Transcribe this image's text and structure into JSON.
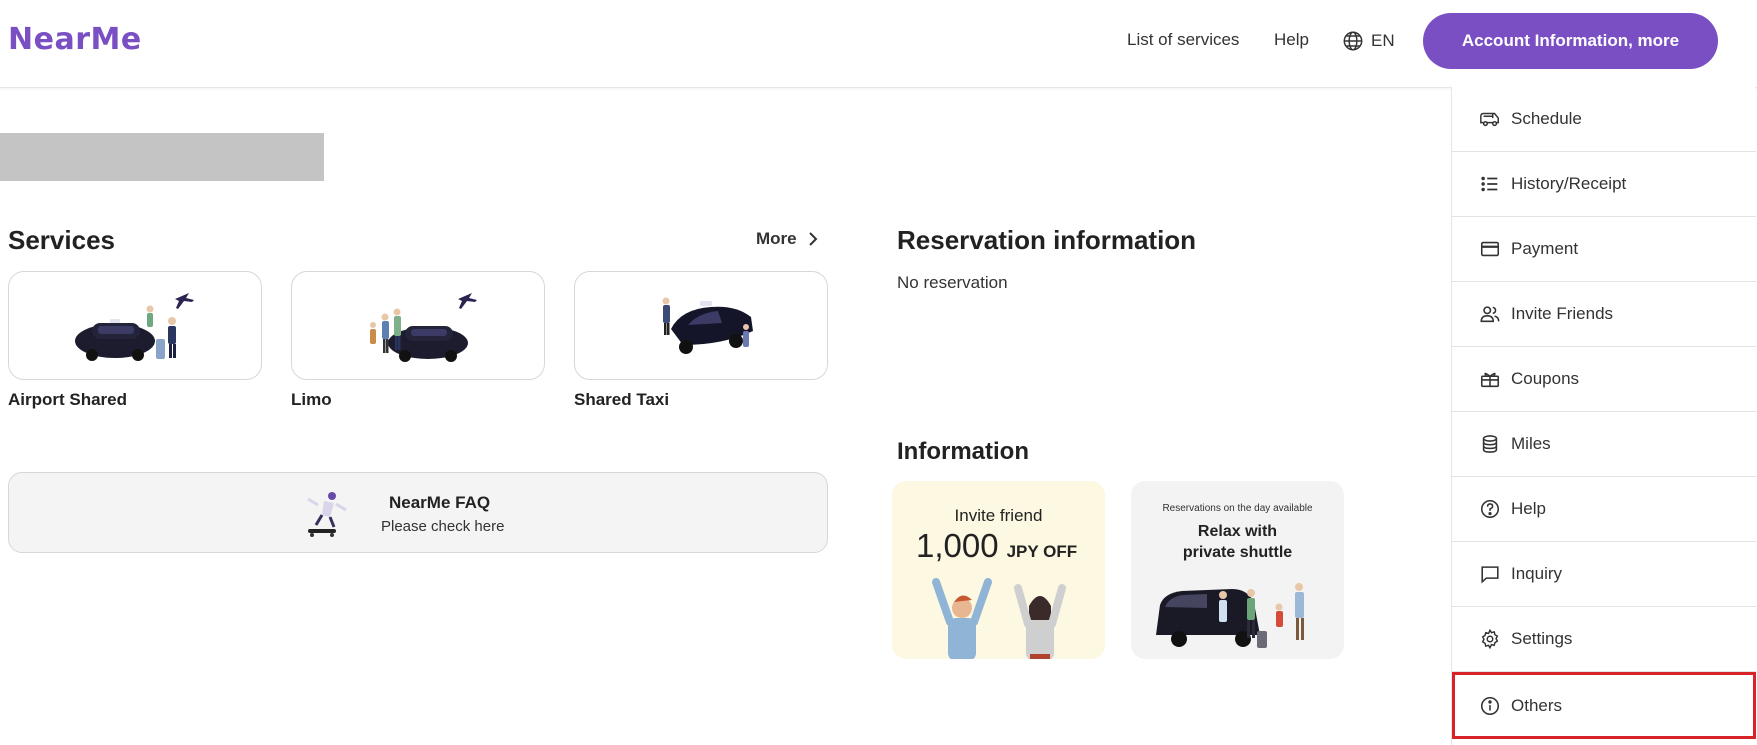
{
  "header": {
    "logo": "NearMe",
    "nav_services": "List of services",
    "nav_help": "Help",
    "nav_lang": "EN",
    "account_button": "Account Information, more"
  },
  "services": {
    "title": "Services",
    "more": "More",
    "items": [
      {
        "label": "Airport Shared"
      },
      {
        "label": "Limo"
      },
      {
        "label": "Shared Taxi"
      }
    ]
  },
  "faq": {
    "title": "NearMe FAQ",
    "subtitle": "Please check here"
  },
  "reservation": {
    "title": "Reservation information",
    "status": "No reservation"
  },
  "information": {
    "title": "Information",
    "banner1": {
      "line1": "Invite friend",
      "amount": "1,000",
      "unit": "JPY OFF"
    },
    "banner2": {
      "small": "Reservations on the day available",
      "line1": "Relax with",
      "line2": "private shuttle"
    }
  },
  "menu": {
    "items": [
      {
        "label": "Schedule",
        "icon": "shuttle-icon"
      },
      {
        "label": "History/Receipt",
        "icon": "list-icon"
      },
      {
        "label": "Payment",
        "icon": "credit-card-icon"
      },
      {
        "label": "Invite Friends",
        "icon": "users-icon"
      },
      {
        "label": "Coupons",
        "icon": "coupon-icon"
      },
      {
        "label": "Miles",
        "icon": "coins-icon"
      },
      {
        "label": "Help",
        "icon": "question-icon"
      },
      {
        "label": "Inquiry",
        "icon": "chat-icon"
      },
      {
        "label": "Settings",
        "icon": "gear-icon"
      },
      {
        "label": "Others",
        "icon": "info-icon"
      }
    ],
    "highlighted": "Others"
  },
  "colors": {
    "brand": "#7a4fc4",
    "highlight_border": "#d6232a"
  }
}
